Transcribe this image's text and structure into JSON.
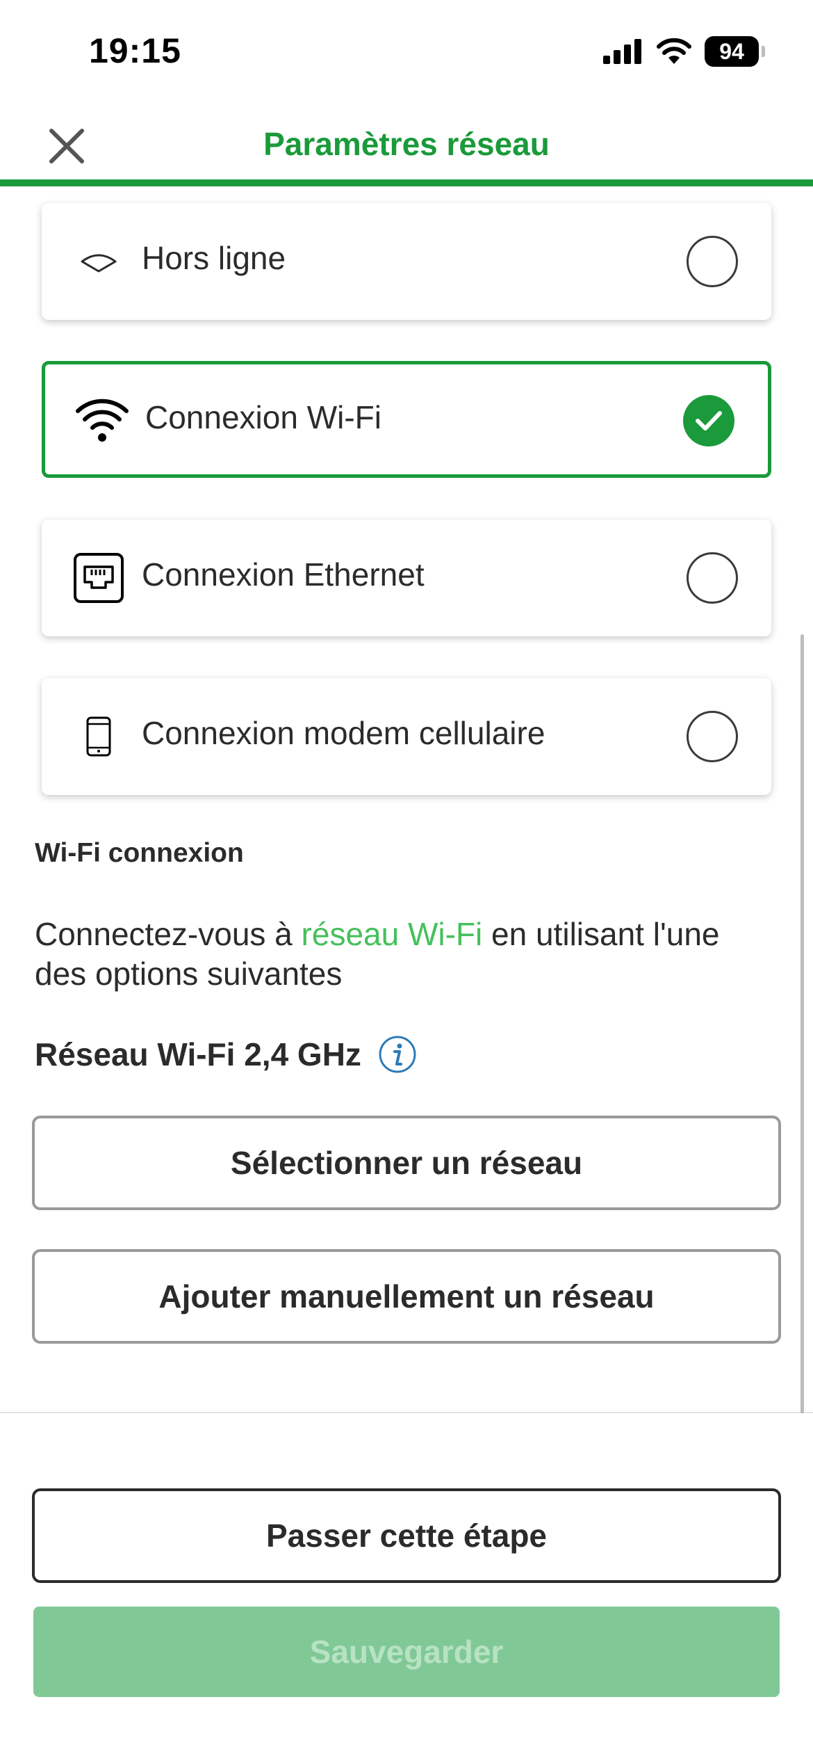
{
  "status_bar": {
    "time": "19:15",
    "battery": "94"
  },
  "header": {
    "title": "Paramètres réseau"
  },
  "options": [
    {
      "label": "Hors ligne",
      "icon": "offline-icon",
      "selected": false
    },
    {
      "label": "Connexion Wi-Fi",
      "icon": "wifi-icon",
      "selected": true
    },
    {
      "label": "Connexion Ethernet",
      "icon": "ethernet-icon",
      "selected": false
    },
    {
      "label": "Connexion modem cellulaire",
      "icon": "phone-icon",
      "selected": false
    }
  ],
  "wifi_section": {
    "title": "Wi-Fi connexion",
    "desc_before": "Connectez-vous à ",
    "desc_highlight": "réseau Wi-Fi",
    "desc_after": " en utilisant l'une des options suivantes",
    "band_label": "Réseau Wi-Fi 2,4 GHz",
    "select_network_label": "Sélectionner un réseau",
    "add_network_label": "Ajouter manuellement un réseau"
  },
  "footer": {
    "skip_label": "Passer cette étape",
    "save_label": "Sauvegarder"
  },
  "colors": {
    "accent": "#1a9a3a",
    "link": "#45c05a",
    "save_disabled_bg": "#80c996",
    "info_icon": "#2a7ab8"
  }
}
